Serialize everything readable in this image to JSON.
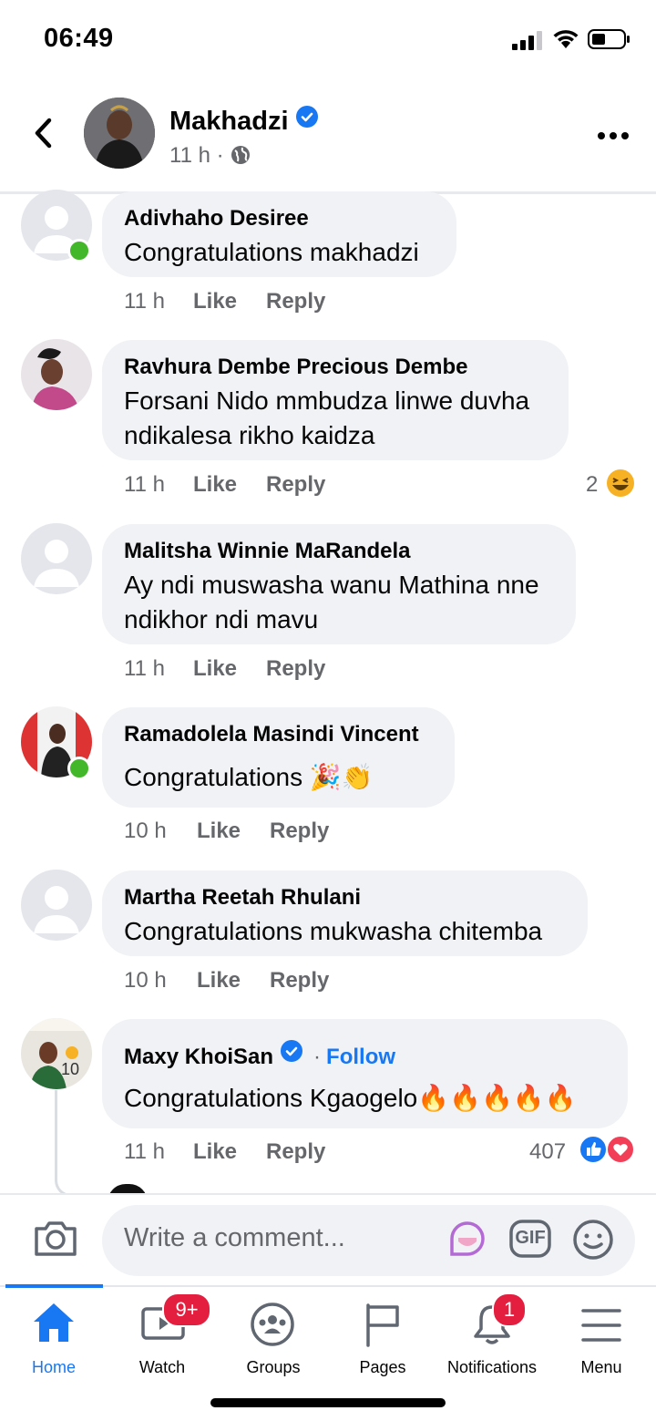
{
  "status_bar": {
    "time": "06:49"
  },
  "post": {
    "author": "Makhadzi",
    "time": "11 h",
    "separator": "·"
  },
  "comments": [
    {
      "name": "Adivhaho Desiree",
      "text": "Congratulations makhadzi",
      "time": "11 h",
      "like": "Like",
      "reply": "Reply"
    },
    {
      "name": "Ravhura Dembe Precious Dembe",
      "text_line1": "Forsani Nido mmbudza linwe duvha",
      "text_line2": "ndikalesa rikho kaidza",
      "time": "11 h",
      "like": "Like",
      "reply": "Reply",
      "reaction_count": "2",
      "reaction_icon": "haha-icon"
    },
    {
      "name": "Malitsha Winnie MaRandela",
      "text_line1": "Ay ndi muswasha wanu Mathina nne",
      "text_line2": "ndikhor ndi mavu",
      "time": "11 h",
      "like": "Like",
      "reply": "Reply"
    },
    {
      "name": "Ramadolela Masindi Vincent",
      "text": "Congratulations",
      "emojis": "🎉👏",
      "time": "10 h",
      "like": "Like",
      "reply": "Reply"
    },
    {
      "name": "Martha Reetah Rhulani",
      "text": "Congratulations mukwasha chitemba",
      "time": "10 h",
      "like": "Like",
      "reply": "Reply"
    },
    {
      "name": "Maxy KhoiSan",
      "follow": "Follow",
      "text": "Congratulations Kgaogelo",
      "emojis": "🔥🔥🔥🔥🔥",
      "time": "11 h",
      "like": "Like",
      "reply": "Reply",
      "reaction_count": "407",
      "reactions": [
        "like-icon",
        "love-icon"
      ]
    }
  ],
  "composer": {
    "placeholder": "Write a comment...",
    "gif_label": "GIF"
  },
  "tabs": [
    {
      "label": "Home",
      "active": true
    },
    {
      "label": "Watch",
      "badge": "9+"
    },
    {
      "label": "Groups"
    },
    {
      "label": "Pages"
    },
    {
      "label": "Notifications",
      "badge": "1"
    },
    {
      "label": "Menu"
    }
  ],
  "colors": {
    "accent": "#1877f2",
    "bubble": "#f0f2f5",
    "secondary_text": "#65676b",
    "badge": "#e41e3f",
    "online": "#42b72a"
  }
}
